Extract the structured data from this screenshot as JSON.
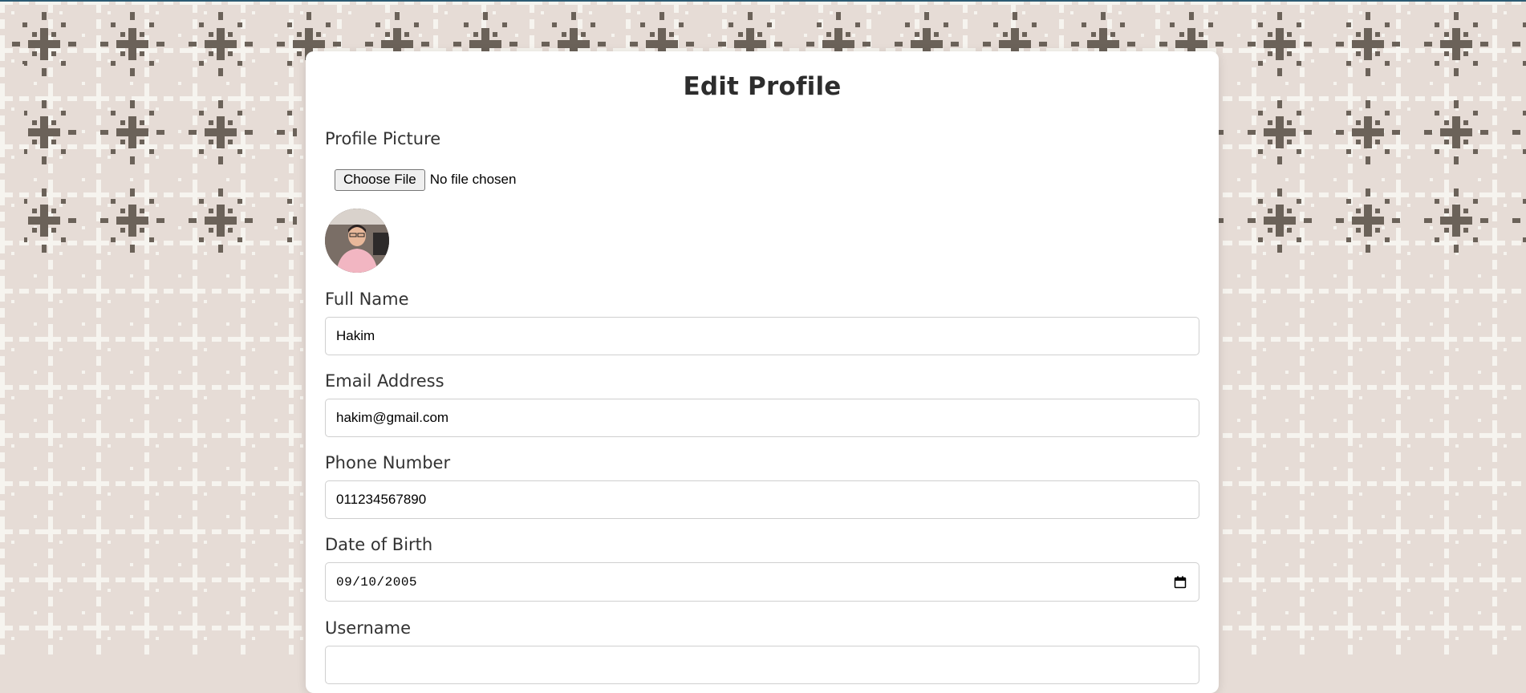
{
  "page": {
    "title": "Edit Profile"
  },
  "profile_picture": {
    "label": "Profile Picture",
    "choose_button": "Choose File",
    "file_status": "No file chosen"
  },
  "fields": {
    "full_name": {
      "label": "Full Name",
      "value": "Hakim"
    },
    "email": {
      "label": "Email Address",
      "value": "hakim@gmail.com"
    },
    "phone": {
      "label": "Phone Number",
      "value": "011234567890"
    },
    "dob": {
      "label": "Date of Birth",
      "value": "09/10/2005"
    },
    "username": {
      "label": "Username"
    }
  },
  "icons": {
    "calendar": "calendar-icon",
    "avatar": "avatar"
  },
  "colors": {
    "background": "#e6dcd6",
    "pattern_dark": "#6b6259",
    "pattern_light": "#f6f4ef",
    "card": "#ffffff",
    "text": "#333333",
    "top_line": "#2b5b73"
  }
}
